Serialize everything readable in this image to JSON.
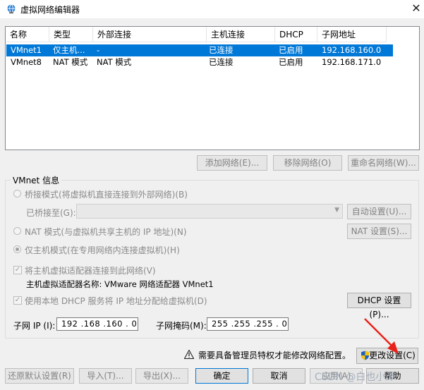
{
  "window": {
    "title": "虚拟网络编辑器",
    "close_glyph": "✕",
    "app_icon": "network-globe-icon"
  },
  "table": {
    "columns": [
      "名称",
      "类型",
      "外部连接",
      "主机连接",
      "DHCP",
      "子网地址"
    ],
    "rows": [
      {
        "name": "VMnet1",
        "type": "仅主机...",
        "external": "-",
        "host": "已连接",
        "dhcp": "已启用",
        "subnet": "192.168.160.0",
        "selected": true
      },
      {
        "name": "VMnet8",
        "type": "NAT 模式",
        "external": "NAT 模式",
        "host": "已连接",
        "dhcp": "已启用",
        "subnet": "192.168.171.0",
        "selected": false
      }
    ]
  },
  "table_buttons": {
    "add": "添加网络(E)...",
    "remove": "移除网络(O)",
    "rename": "重命名网络(W)..."
  },
  "group": {
    "title": "VMnet 信息",
    "bridge_label": "桥接模式(将虚拟机直接连接到外部网络)(B)",
    "bridged_to_label": "已桥接至(G):",
    "bridged_to_value": "",
    "auto_settings": "自动设置(U)...",
    "nat_label": "NAT 模式(与虚拟机共享主机的 IP 地址)(N)",
    "nat_settings": "NAT 设置(S)...",
    "host_only_label": "仅主机模式(在专用网络内连接虚拟机)(H)",
    "selected_mode": "host_only",
    "connect_adapter_label": "将主机虚拟适配器连接到此网络(V)",
    "connect_adapter_checked": true,
    "adapter_name_label": "主机虚拟适配器名称: VMware 网络适配器 VMnet1",
    "dhcp_label": "使用本地 DHCP 服务将 IP 地址分配给虚拟机(D)",
    "dhcp_checked": true,
    "dhcp_settings": "DHCP 设置(P)...",
    "subnet_ip_label": "子网 IP (I):",
    "subnet_ip_value": "192 .168 .160 . 0",
    "subnet_mask_label": "子网掩码(M):",
    "subnet_mask_value": "255 .255 .255 . 0"
  },
  "admin": {
    "warning_text": "需要具备管理员特权才能修改网络配置。",
    "change_settings": "更改设置(C)"
  },
  "footer": {
    "restore": "还原默认设置(R)",
    "import": "导入(T)...",
    "export": "导出(X)...",
    "ok": "确定",
    "cancel": "取消",
    "apply": "应用(A)",
    "help": "帮助"
  },
  "watermark": "CSDN @白也小泽",
  "colors": {
    "selection": "#0078d7",
    "arrow": "#e8221a",
    "disabled_text": "#838383"
  }
}
